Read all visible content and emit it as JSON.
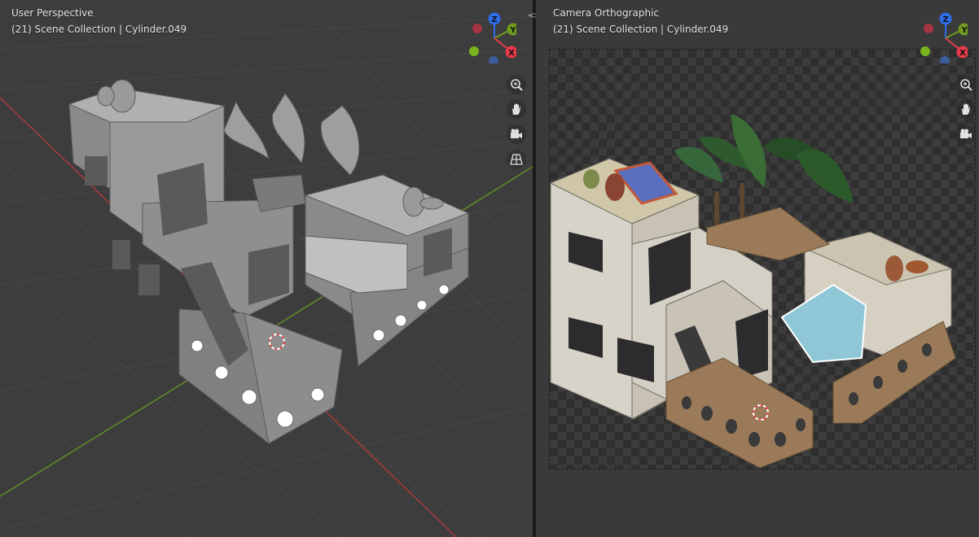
{
  "left_viewport": {
    "view_name": "User Perspective",
    "collection_info": "(21) Scene Collection | Cylinder.049"
  },
  "right_viewport": {
    "view_name": "Camera Orthographic",
    "collection_info": "(21) Scene Collection | Cylinder.049"
  },
  "gizmo": {
    "z_label": "Z",
    "y_label": "Y",
    "x_label": "X",
    "colors": {
      "z": "#2f6ee8",
      "y": "#6f9b1e",
      "x": "#e83a4a",
      "neg_x": "#a53444",
      "neg_y": "#5f8a25",
      "neg_z": "#3c5d9c"
    }
  },
  "nav_tools": [
    "zoom-icon",
    "hand-pan-icon",
    "camera-icon",
    "grid-perspective-icon"
  ],
  "divider_glyph": "<>",
  "colors": {
    "viewport_bg": "#3d3d3d",
    "grid_line": "#484848",
    "x_axis": "#a83a3a",
    "y_axis": "#5f8f23"
  }
}
